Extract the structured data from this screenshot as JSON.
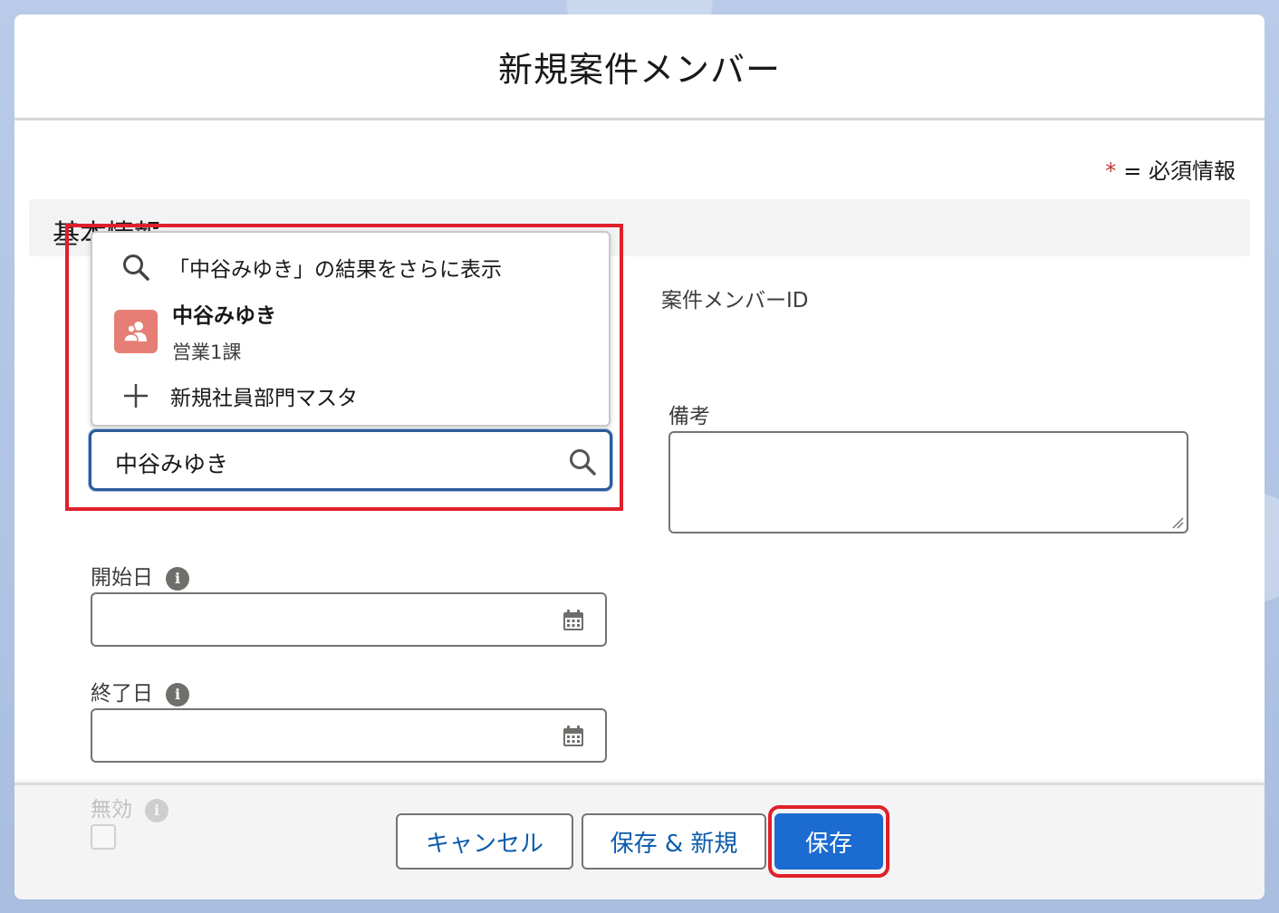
{
  "modal": {
    "title": "新規案件メンバー",
    "required_legend_star": "*",
    "required_legend_text": "= 必須情報"
  },
  "section": {
    "title": "基本情報"
  },
  "lookup": {
    "value": "中谷みゆき",
    "dropdown": {
      "more_results_label": "「中谷みゆき」の結果をさらに表示",
      "result_name": "中谷みゆき",
      "result_subtitle": "営業1課",
      "new_record_label": "新規社員部門マスタ"
    }
  },
  "fields": {
    "member_id_label": "案件メンバーID",
    "notes_label": "備考",
    "notes_value": "",
    "start_date_label": "開始日",
    "start_date_value": "",
    "end_date_label": "終了日",
    "end_date_value": "",
    "inactive_label": "無効",
    "inactive_checked": false
  },
  "footer": {
    "cancel_label": "キャンセル",
    "save_new_label": "保存 & 新規",
    "save_label": "保存"
  },
  "icons": {
    "search": "search-icon",
    "plus": "plus-icon",
    "user": "user-group-icon",
    "calendar": "calendar-icon",
    "info": "info-icon"
  },
  "colors": {
    "brand_button": "#1b6bd1",
    "highlight_outline": "#e0202a",
    "avatar_bg": "#e67e75",
    "required_star": "#c23934"
  }
}
